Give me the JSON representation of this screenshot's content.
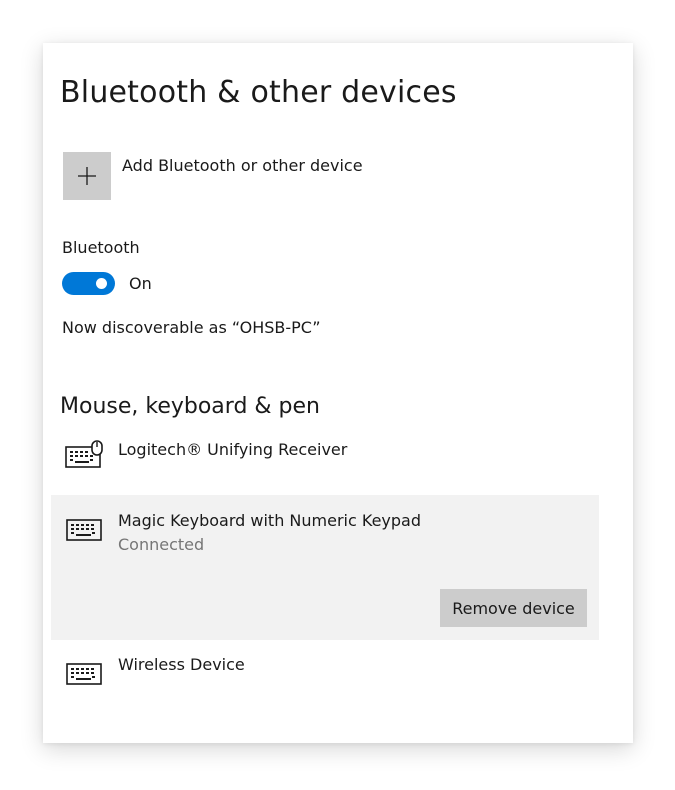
{
  "header": {
    "title": "Bluetooth & other devices"
  },
  "add_device": {
    "label": "Add Bluetooth or other device",
    "icon": "plus-icon"
  },
  "bluetooth": {
    "label": "Bluetooth",
    "toggle_state": "On",
    "enabled": true,
    "discoverable_text": "Now discoverable as “OHSB-PC”",
    "accent_color": "#0078d7"
  },
  "mouse_keyboard_pen": {
    "title": "Mouse, keyboard & pen",
    "devices": [
      {
        "name": "Logitech® Unifying Receiver",
        "icon": "keyboard-mouse-icon",
        "status": ""
      },
      {
        "name": "Magic Keyboard with Numeric Keypad",
        "icon": "keyboard-icon",
        "status": "Connected",
        "selected": true,
        "action_label": "Remove device"
      },
      {
        "name": "Wireless Device",
        "icon": "keyboard-icon",
        "status": ""
      }
    ]
  }
}
